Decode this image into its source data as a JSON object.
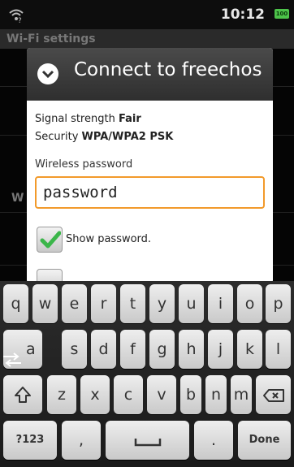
{
  "status_bar": {
    "time": "10:12",
    "battery": "100"
  },
  "background": {
    "title": "Wi-Fi settings",
    "section_letter": "W"
  },
  "dialog": {
    "title": "Connect to freechos",
    "signal_label": "Signal strength",
    "signal_value": "Fair",
    "security_label": "Security",
    "security_value": "WPA/WPA2 PSK",
    "password_label": "Wireless password",
    "password_value": "password",
    "show_password_label": "Show password.",
    "show_password_checked": true
  },
  "keyboard": {
    "row1": [
      "q",
      "w",
      "e",
      "r",
      "t",
      "y",
      "u",
      "i",
      "o",
      "p"
    ],
    "row2": [
      "a",
      "s",
      "d",
      "f",
      "g",
      "h",
      "j",
      "k",
      "l"
    ],
    "row3": [
      "z",
      "x",
      "c",
      "v",
      "b",
      "n",
      "m"
    ],
    "symbols_label": "?123",
    "comma_label": ",",
    "period_label": ".",
    "done_label": "Done"
  },
  "colors": {
    "accent": "#f29a2b",
    "check": "#3bb64a"
  }
}
